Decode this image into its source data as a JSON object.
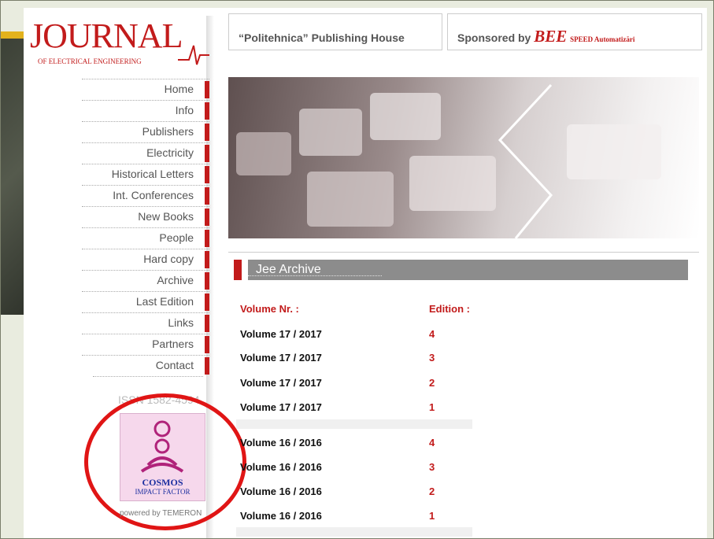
{
  "logo": {
    "title": "JOURNAL",
    "subtitle": "OF ELECTRICAL ENGINEERING"
  },
  "nav": [
    "Home",
    "Info",
    "Publishers",
    "Electricity",
    "Historical Letters",
    "Int. Conferences",
    "New Books",
    "People",
    "Hard copy",
    "Archive",
    "Last Edition",
    "Links",
    "Partners",
    "Contact"
  ],
  "issn": "ISSN 1582-4594",
  "cosmos": {
    "title": "COSMOS",
    "subtitle": "IMPACT FACTOR"
  },
  "powered": "powered by TEMERON",
  "header": {
    "publisher": "“Politehnica” Publishing House",
    "sponsored": "Sponsored by",
    "bee": "BEE",
    "bee_sub": "SPEED Automatizări"
  },
  "archive": {
    "title": "Jee Archive",
    "col_volume": "Volume Nr. :",
    "col_edition": "Edition :",
    "rows": [
      {
        "volume": "Volume 17 / 2017",
        "edition": "4"
      },
      {
        "volume": "Volume 17 / 2017",
        "edition": "3"
      },
      {
        "volume": "Volume 17 / 2017",
        "edition": "2"
      },
      {
        "volume": "Volume 17 / 2017",
        "edition": "1"
      },
      {
        "volume": "Volume 16 / 2016",
        "edition": "4"
      },
      {
        "volume": "Volume 16 / 2016",
        "edition": "3"
      },
      {
        "volume": "Volume 16 / 2016",
        "edition": "2"
      },
      {
        "volume": "Volume 16 / 2016",
        "edition": "1"
      }
    ]
  },
  "colors": {
    "accent": "#c21b1b",
    "highlight_circle": "#e01515",
    "archive_bar": "#8c8c8c"
  }
}
